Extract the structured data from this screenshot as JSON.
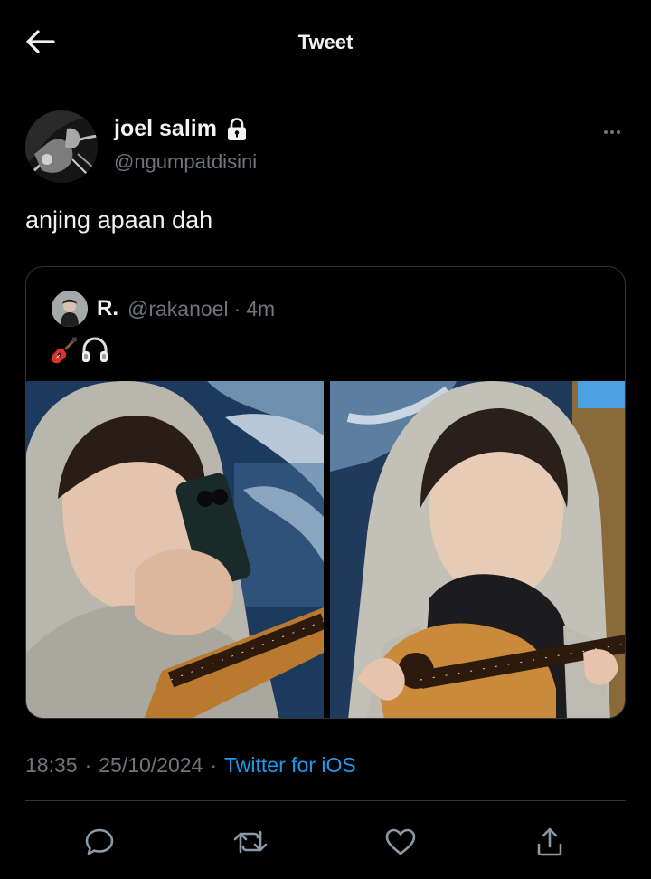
{
  "header": {
    "title": "Tweet"
  },
  "tweet": {
    "display_name": "joel salim",
    "handle": "@ngumpatdisini",
    "text": "anjing apaan dah",
    "time": "18:35",
    "date": "25/10/2024",
    "separator": "·",
    "source": "Twitter for iOS"
  },
  "quote": {
    "display_name": "R.",
    "handle": "@rakanoel",
    "separator": "·",
    "time": "4m",
    "emojis": [
      "guitar-icon",
      "headphones-icon"
    ]
  },
  "icons": {
    "back": "arrow-left-icon",
    "lock": "lock-icon",
    "more": "more-horizontal-icon",
    "reply": "reply-icon",
    "retweet": "retweet-icon",
    "like": "heart-icon",
    "share": "share-icon"
  },
  "colors": {
    "background": "#000000",
    "text": "#e7e9ea",
    "muted": "#71767b",
    "link": "#1d9bf0",
    "border": "#2f3336"
  }
}
